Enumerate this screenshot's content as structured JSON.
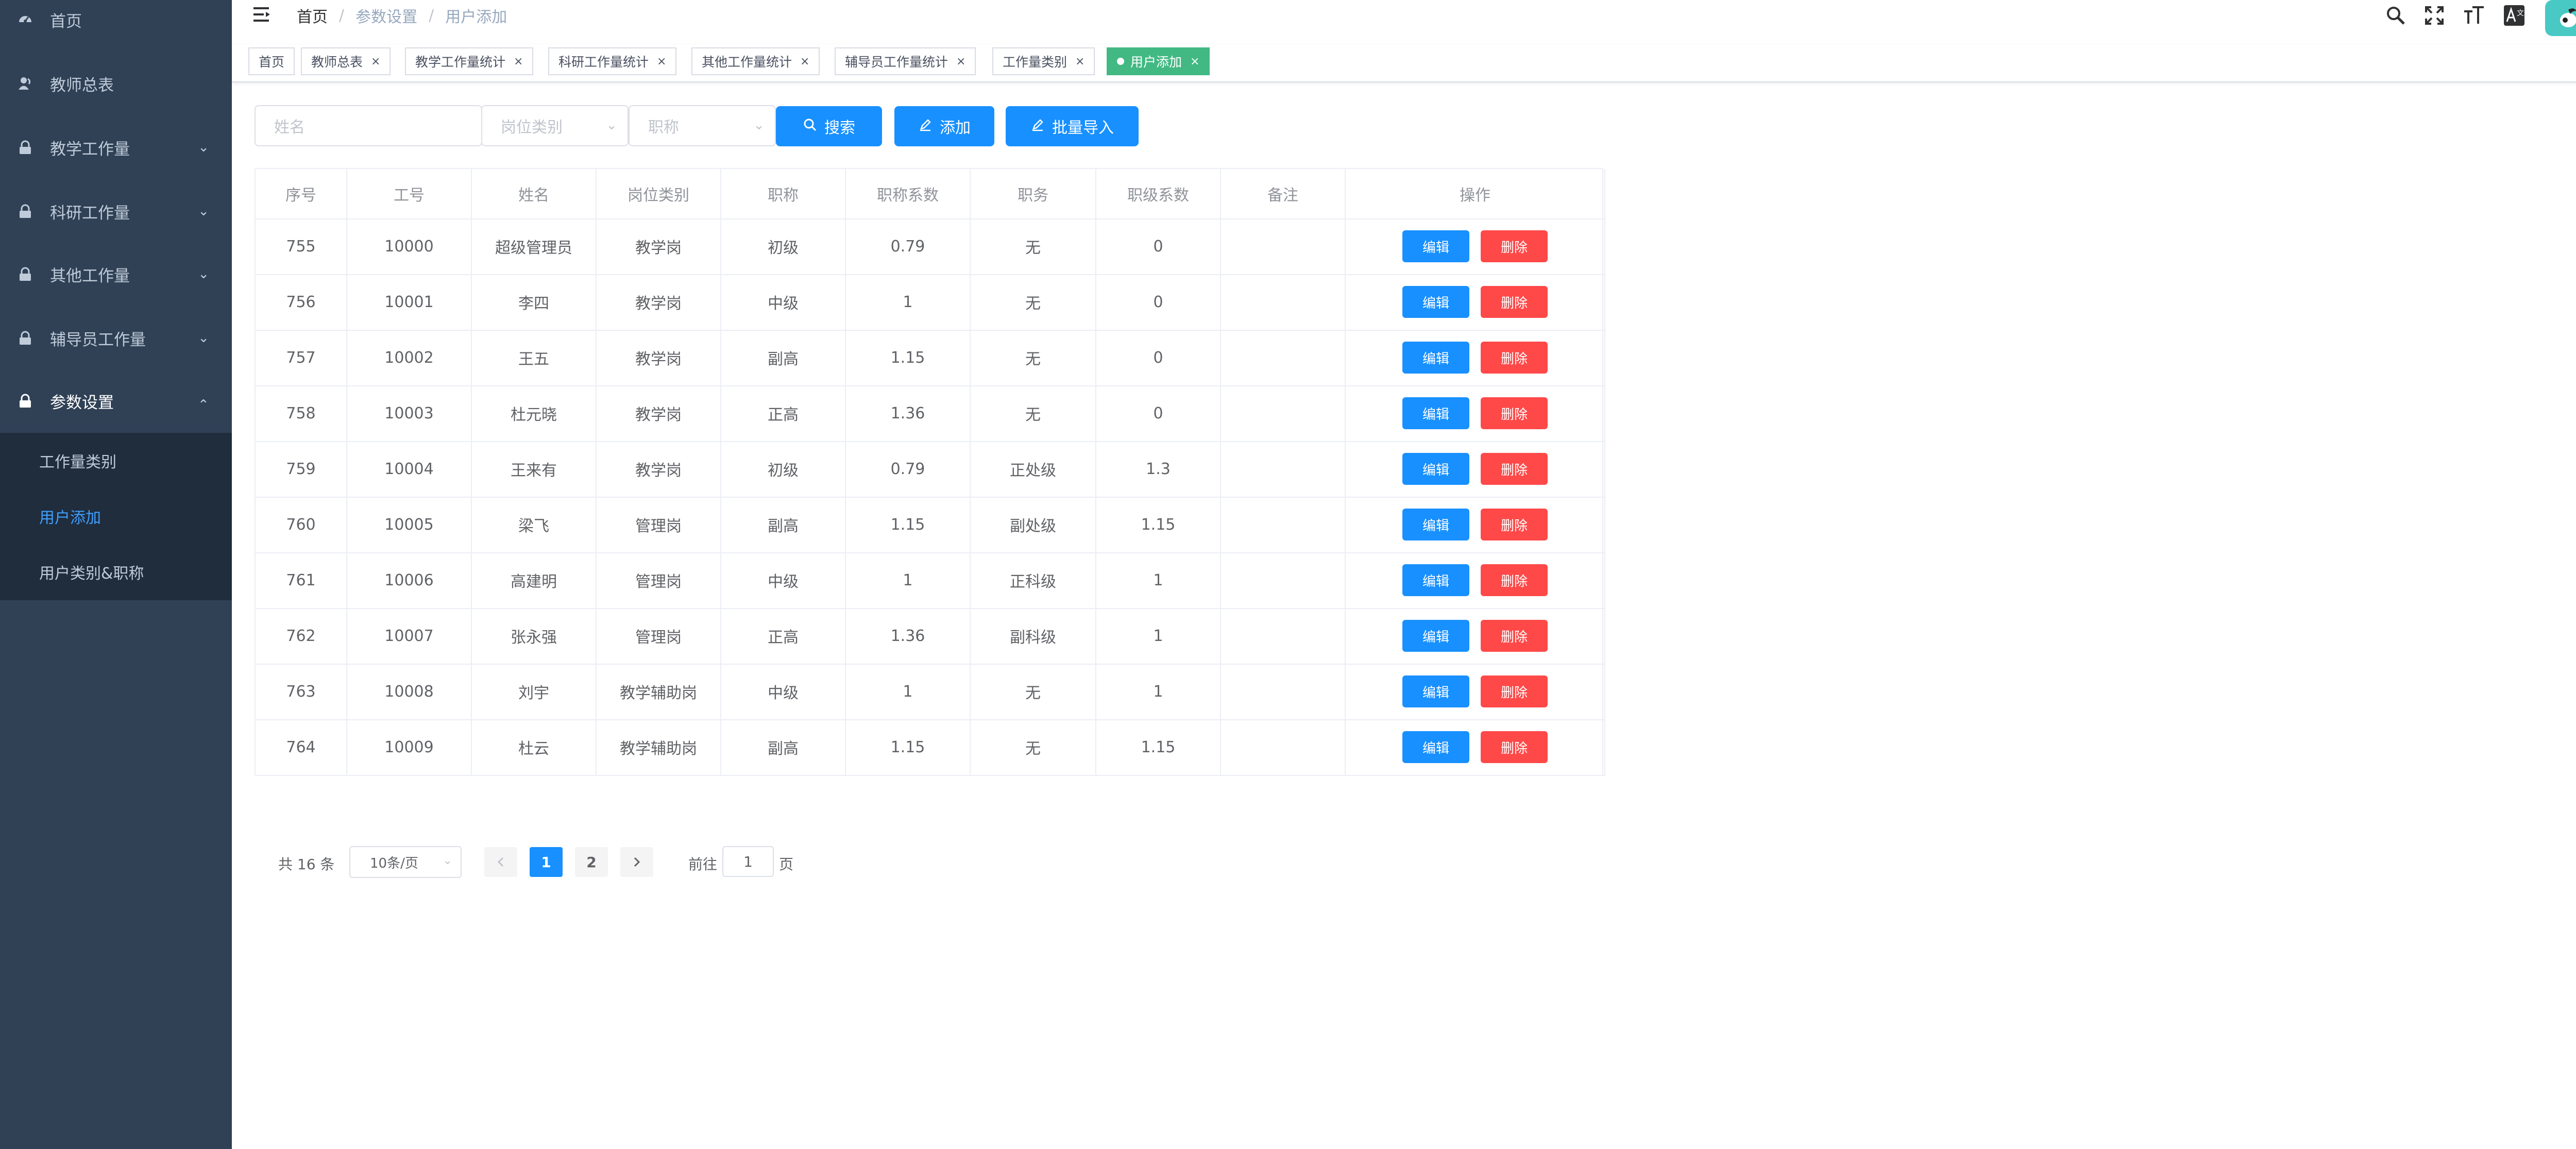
{
  "sidebar": {
    "items": [
      {
        "label": "首页",
        "icon": "dashboard-icon"
      },
      {
        "label": "教师总表",
        "icon": "user-icon"
      },
      {
        "label": "教学工作量",
        "icon": "lock-icon"
      },
      {
        "label": "科研工作量",
        "icon": "lock-icon"
      },
      {
        "label": "其他工作量",
        "icon": "lock-icon"
      },
      {
        "label": "辅导员工作量",
        "icon": "lock-icon"
      },
      {
        "label": "参数设置",
        "icon": "lock-icon"
      }
    ],
    "submenu": [
      {
        "label": "工作量类别"
      },
      {
        "label": "用户添加"
      },
      {
        "label": "用户类别&职称"
      }
    ],
    "active_submenu": "用户添加",
    "colors": {
      "background": "#304156",
      "submenu_background": "#1f2d3d",
      "active_text": "#409eff"
    }
  },
  "navbar": {
    "breadcrumb": [
      "首页",
      "参数设置",
      "用户添加"
    ],
    "breadcrumb_separator": "/",
    "icons": [
      "search-icon",
      "fullscreen-icon",
      "font-size-icon",
      "language-icon"
    ]
  },
  "tags": [
    {
      "label": "首页",
      "closable": false
    },
    {
      "label": "教师总表",
      "closable": true
    },
    {
      "label": "教学工作量统计",
      "closable": true
    },
    {
      "label": "科研工作量统计",
      "closable": true
    },
    {
      "label": "其他工作量统计",
      "closable": true
    },
    {
      "label": "辅导员工作量统计",
      "closable": true
    },
    {
      "label": "工作量类别",
      "closable": true
    },
    {
      "label": "用户添加",
      "closable": true,
      "active": true
    }
  ],
  "tag_close_glyph": "×",
  "filters": {
    "name_placeholder": "姓名",
    "position_placeholder": "岗位类别",
    "title_placeholder": "职称",
    "search_label": "搜索",
    "add_label": "添加",
    "import_label": "批量导入"
  },
  "table": {
    "columns": [
      "序号",
      "工号",
      "姓名",
      "岗位类别",
      "职称",
      "职称系数",
      "职务",
      "职级系数",
      "备注",
      "操作"
    ],
    "rows": [
      [
        "755",
        "10000",
        "超级管理员",
        "教学岗",
        "初级",
        "0.79",
        "无",
        "0",
        ""
      ],
      [
        "756",
        "10001",
        "李四",
        "教学岗",
        "中级",
        "1",
        "无",
        "0",
        ""
      ],
      [
        "757",
        "10002",
        "王五",
        "教学岗",
        "副高",
        "1.15",
        "无",
        "0",
        ""
      ],
      [
        "758",
        "10003",
        "杜元晓",
        "教学岗",
        "正高",
        "1.36",
        "无",
        "0",
        ""
      ],
      [
        "759",
        "10004",
        "王来有",
        "教学岗",
        "初级",
        "0.79",
        "正处级",
        "1.3",
        ""
      ],
      [
        "760",
        "10005",
        "梁飞",
        "管理岗",
        "副高",
        "1.15",
        "副处级",
        "1.15",
        ""
      ],
      [
        "761",
        "10006",
        "高建明",
        "管理岗",
        "中级",
        "1",
        "正科级",
        "1",
        ""
      ],
      [
        "762",
        "10007",
        "张永强",
        "管理岗",
        "正高",
        "1.36",
        "副科级",
        "1",
        ""
      ],
      [
        "763",
        "10008",
        "刘宇",
        "教学辅助岗",
        "中级",
        "1",
        "无",
        "1",
        ""
      ],
      [
        "764",
        "10009",
        "杜云",
        "教学辅助岗",
        "副高",
        "1.15",
        "无",
        "1.15",
        ""
      ]
    ],
    "edit_label": "编辑",
    "delete_label": "删除",
    "edit_color": "#1890ff",
    "delete_color": "#ff4949"
  },
  "pagination": {
    "total_text": "共 16 条",
    "page_size": "10条/页",
    "pages": [
      "1",
      "2"
    ],
    "current_page": "1",
    "goto_label": "前往",
    "goto_value": "1",
    "page_unit": "页"
  }
}
